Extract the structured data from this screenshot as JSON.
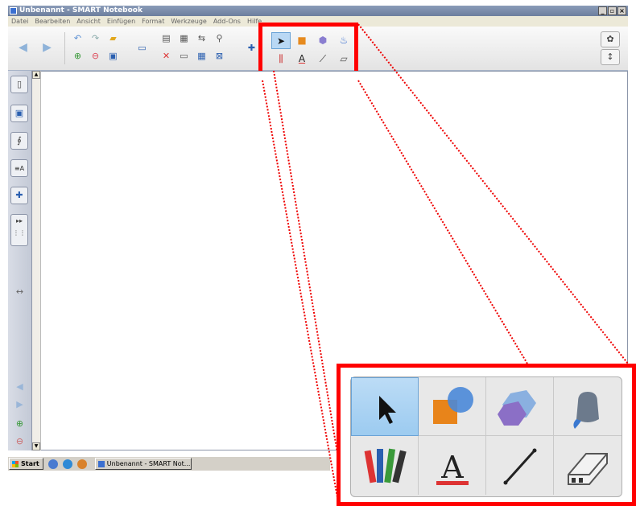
{
  "window": {
    "title": "Unbenannt - SMART Notebook",
    "controls": {
      "minimize": "_",
      "maximize": "▫",
      "close": "×"
    }
  },
  "menu": {
    "items": [
      "Datei",
      "Bearbeiten",
      "Ansicht",
      "Einfügen",
      "Format",
      "Werkzeuge",
      "Add-Ons",
      "Hilfe"
    ]
  },
  "toolbar": {
    "icons": [
      "back-arrow-icon",
      "forward-arrow-icon",
      "undo-icon",
      "redo-icon",
      "open-folder-icon",
      "add-page-icon",
      "delete-page-icon",
      "save-icon",
      "screen-icon",
      "paste-icon",
      "screen-shade-icon",
      "delete-icon",
      "present-icon",
      "table-icon",
      "close-box-icon",
      "puzzle-icon"
    ],
    "settings_icon": "gear-icon",
    "move_icon": "up-down-arrow-icon"
  },
  "tools": {
    "items": [
      {
        "name": "select-tool",
        "icon": "cursor-arrow-icon",
        "active": true
      },
      {
        "name": "shapes-tool",
        "icon": "shapes-icon"
      },
      {
        "name": "regular-polygon-tool",
        "icon": "polygon-icon"
      },
      {
        "name": "fill-tool",
        "icon": "paint-bucket-icon"
      },
      {
        "name": "pens-tool",
        "icon": "pens-icon"
      },
      {
        "name": "text-tool",
        "icon": "letter-a-icon",
        "glyph": "A"
      },
      {
        "name": "lines-tool",
        "icon": "line-icon"
      },
      {
        "name": "eraser-tool",
        "icon": "eraser-icon"
      }
    ]
  },
  "sidebar": {
    "icons": [
      "page-sorter-icon",
      "gallery-icon",
      "attachments-icon",
      "properties-icon",
      "add-ons-icon",
      "expand-icon",
      "resize-arrows-icon",
      "prev-icon",
      "next-icon",
      "add-page-icon",
      "delete-page-icon"
    ]
  },
  "taskbar": {
    "start_label": "Start",
    "task_label": "Unbenannt - SMART Not..."
  },
  "colors": {
    "highlight": "#ff0000",
    "active_tool": "#9ccbf0",
    "title_bar": "#7b8cab"
  }
}
